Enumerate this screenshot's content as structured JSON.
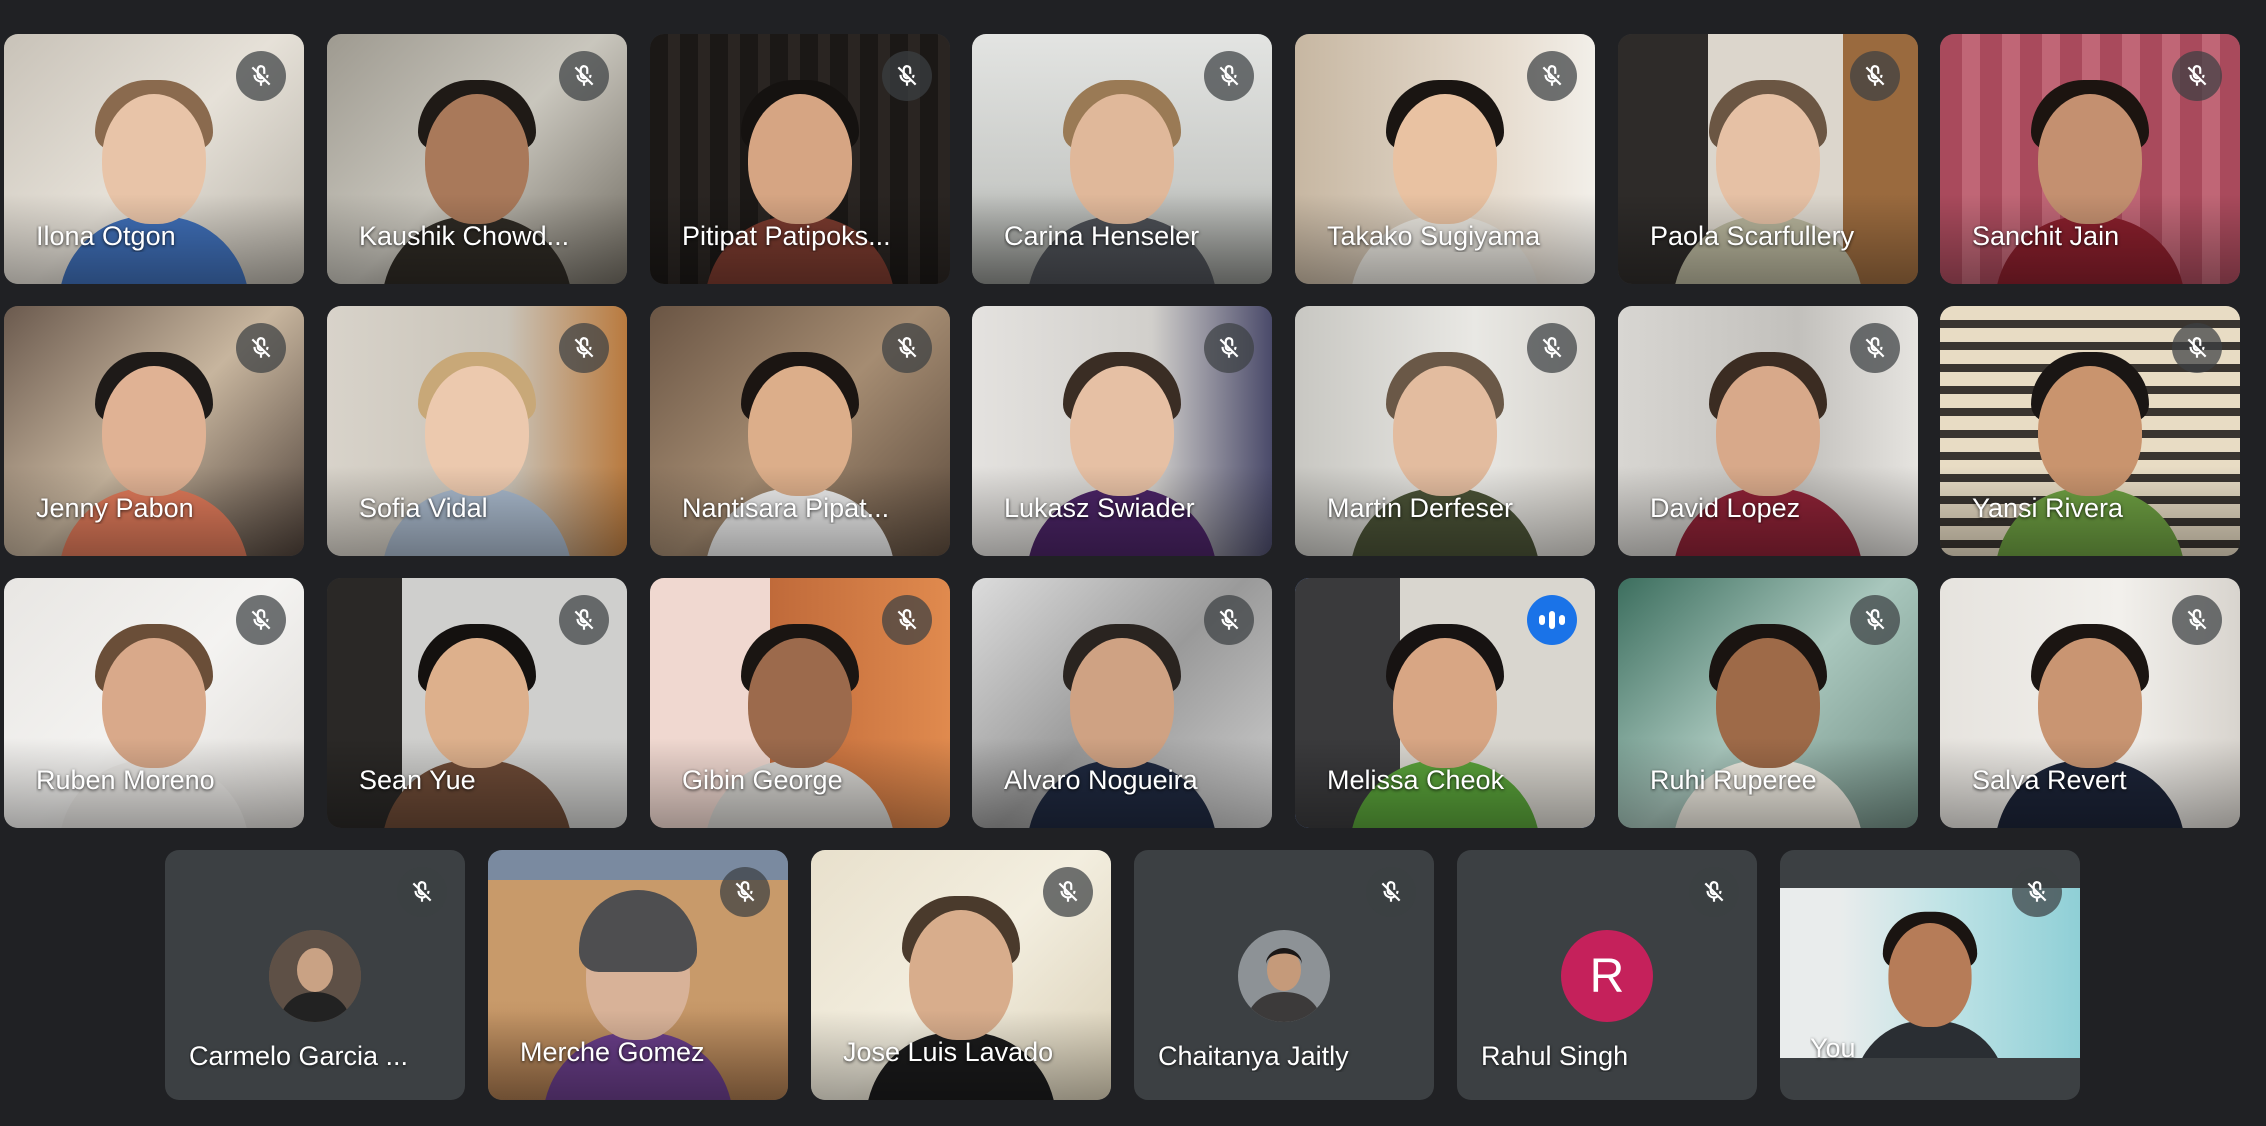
{
  "participants": {
    "row1": [
      {
        "name": "Ilona Otgon",
        "mic": "muted-mic-icon"
      },
      {
        "name": "Kaushik Chowd...",
        "mic": "muted-mic-icon"
      },
      {
        "name": "Pitipat Patipoks...",
        "mic": "muted-mic-icon"
      },
      {
        "name": "Carina Henseler",
        "mic": "muted-mic-icon"
      },
      {
        "name": "Takako Sugiyama",
        "mic": "muted-mic-icon"
      },
      {
        "name": "Paola Scarfullery",
        "mic": "muted-mic-icon"
      },
      {
        "name": "Sanchit Jain",
        "mic": "muted-mic-icon"
      }
    ],
    "row2": [
      {
        "name": "Jenny Pabon",
        "mic": "muted-mic-icon"
      },
      {
        "name": "Sofia Vidal",
        "mic": "muted-mic-icon"
      },
      {
        "name": "Nantisara Pipat...",
        "mic": "muted-mic-icon"
      },
      {
        "name": "Lukasz Swiader",
        "mic": "muted-mic-icon"
      },
      {
        "name": "Martin Derfeser",
        "mic": "muted-mic-icon"
      },
      {
        "name": "David Lopez",
        "mic": "muted-mic-icon"
      },
      {
        "name": "Yansi Rivera",
        "mic": "muted-mic-icon"
      }
    ],
    "row3": [
      {
        "name": "Ruben Moreno",
        "mic": "muted-mic-icon"
      },
      {
        "name": "Sean Yue",
        "mic": "muted-mic-icon"
      },
      {
        "name": "Gibin George",
        "mic": "muted-mic-icon"
      },
      {
        "name": "Alvaro Nogueira",
        "mic": "muted-mic-icon"
      },
      {
        "name": "Melissa Cheok",
        "mic": "speaking-indicator-icon",
        "speaking": true
      },
      {
        "name": "Ruhi Ruperee",
        "mic": "muted-mic-icon"
      },
      {
        "name": "Salva Revert",
        "mic": "muted-mic-icon"
      }
    ],
    "row4": [
      {
        "name": "Carmelo Garcia ...",
        "mic": "muted-mic-icon",
        "video": false
      },
      {
        "name": "Merche Gomez",
        "mic": "muted-mic-icon"
      },
      {
        "name": "Jose Luis Lavado",
        "mic": "muted-mic-icon"
      },
      {
        "name": "Chaitanya Jaitly",
        "mic": "muted-mic-icon",
        "video": false
      },
      {
        "name": "Rahul Singh",
        "mic": "muted-mic-icon",
        "video": false,
        "avatar_letter": "R"
      },
      {
        "name": "You",
        "mic": "muted-mic-icon",
        "self": true
      }
    ]
  },
  "colors": {
    "background": "#202124",
    "tile_no_video": "#3c4043",
    "speaking_border": "#5f8ff0",
    "speaking_badge": "#1a73e8",
    "letter_avatar": "#c5215b"
  }
}
